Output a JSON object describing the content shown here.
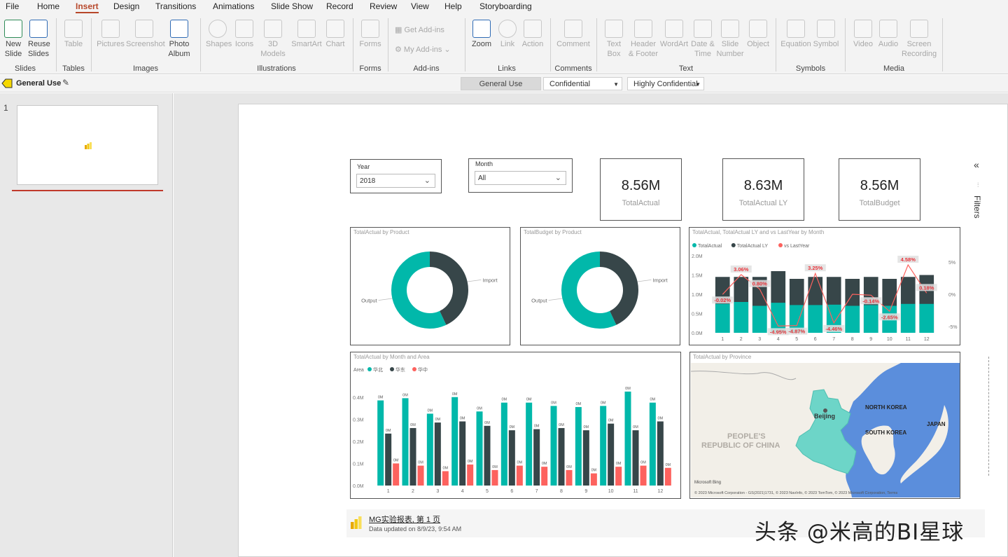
{
  "ribbon_tabs": [
    "File",
    "Home",
    "Insert",
    "Design",
    "Transitions",
    "Animations",
    "Slide Show",
    "Record",
    "Review",
    "View",
    "Help",
    "Storyboarding"
  ],
  "active_tab": "Insert",
  "ribbon": {
    "slides": {
      "new_slide": "New",
      "new_slide2": "Slide",
      "reuse": "Reuse",
      "reuse2": "Slides",
      "label": "Slides"
    },
    "tables": {
      "table": "Table",
      "label": "Tables"
    },
    "images": {
      "pictures": "Pictures",
      "screenshot": "Screenshot",
      "photo": "Photo",
      "album": "Album",
      "label": "Images"
    },
    "illustrations": {
      "shapes": "Shapes",
      "icons": "Icons",
      "models": "3D",
      "models2": "Models",
      "smartart": "SmartArt",
      "chart": "Chart",
      "label": "Illustrations"
    },
    "forms": {
      "forms": "Forms",
      "label": "Forms"
    },
    "addins": {
      "get": "Get Add-ins",
      "my": "My Add-ins",
      "label": "Add-ins"
    },
    "links": {
      "zoom": "Zoom",
      "link": "Link",
      "action": "Action",
      "label": "Links"
    },
    "comments": {
      "comment": "Comment",
      "label": "Comments"
    },
    "text": {
      "textbox": "Text",
      "textbox2": "Box",
      "header": "Header",
      "header2": "& Footer",
      "wordart": "WordArt",
      "datetime": "Date &",
      "datetime2": "Time",
      "slidenum": "Slide",
      "slidenum2": "Number",
      "object": "Object",
      "label": "Text"
    },
    "symbols": {
      "equation": "Equation",
      "symbol": "Symbol",
      "label": "Symbols"
    },
    "media": {
      "video": "Video",
      "audio": "Audio",
      "screen": "Screen",
      "screen2": "Recording",
      "label": "Media"
    }
  },
  "sensitivity": {
    "current": "General Use",
    "options": [
      "General Use",
      "Confidential",
      "Highly Confidential"
    ]
  },
  "slide_number": "1",
  "report": {
    "year_slicer": {
      "label": "Year",
      "value": "2018"
    },
    "month_slicer": {
      "label": "Month",
      "value": "All"
    },
    "kpis": [
      {
        "value": "8.56M",
        "label": "TotalActual"
      },
      {
        "value": "8.63M",
        "label": "TotalActual LY"
      },
      {
        "value": "8.56M",
        "label": "TotalBudget"
      }
    ],
    "filters_label": "Filters",
    "footer_title": "MG实验报表, 第 1 页",
    "footer_updated": "Data updated on 8/9/23, 9:54 AM"
  },
  "watermark": "头条 @米高的BI星球",
  "chart_data": [
    {
      "type": "pie",
      "title": "TotalActual by Product",
      "categories": [
        "Import",
        "Output"
      ],
      "values": [
        43,
        57
      ],
      "colors": [
        "#374649",
        "#01b8aa"
      ]
    },
    {
      "type": "pie",
      "title": "TotalBudget by Product",
      "categories": [
        "Import",
        "Output"
      ],
      "values": [
        43,
        57
      ],
      "colors": [
        "#374649",
        "#01b8aa"
      ]
    },
    {
      "type": "bar",
      "title": "TotalActual, TotalActual LY and vs LastYear by Month",
      "categories": [
        "1",
        "2",
        "3",
        "4",
        "5",
        "6",
        "7",
        "8",
        "9",
        "10",
        "11",
        "12"
      ],
      "series": [
        {
          "name": "TotalActual",
          "values": [
            0.75,
            0.8,
            0.7,
            0.78,
            0.72,
            0.72,
            0.73,
            0.7,
            0.72,
            0.7,
            0.75,
            0.75
          ],
          "color": "#01b8aa"
        },
        {
          "name": "TotalActual LY",
          "values": [
            1.45,
            1.45,
            1.45,
            1.6,
            1.4,
            1.45,
            1.45,
            1.4,
            1.45,
            1.4,
            1.45,
            1.5
          ],
          "color": "#374649"
        },
        {
          "name": "vs LastYear",
          "values": [
            -0.02,
            3.06,
            0.8,
            -4.95,
            -4.87,
            3.25,
            -4.46,
            null,
            -0.14,
            -2.65,
            4.58,
            0.18
          ],
          "color": "#fd625e",
          "type": "line",
          "axis": "right"
        }
      ],
      "line_labels": [
        "-0.02%",
        "3.06%",
        "0.80%",
        "-4.95%",
        "-4.87%",
        "3.25%",
        "-4.46%",
        "",
        "-0.14%",
        "-2.65%",
        "4.58%",
        "0.18%"
      ],
      "y_ticks": [
        "0.0M",
        "0.5M",
        "1.0M",
        "1.5M",
        "2.0M"
      ],
      "y2_ticks": [
        "5%",
        "0%",
        "-5%"
      ],
      "ylim": [
        0,
        2.0
      ],
      "y2lim": [
        -6,
        6
      ]
    },
    {
      "type": "bar",
      "title": "TotalActual by Month and Area",
      "legend_title": "Area",
      "categories": [
        "1",
        "2",
        "3",
        "4",
        "5",
        "6",
        "7",
        "8",
        "9",
        "10",
        "11",
        "12"
      ],
      "series": [
        {
          "name": "华北",
          "values": [
            0.385,
            0.395,
            0.325,
            0.4,
            0.335,
            0.375,
            0.375,
            0.36,
            0.355,
            0.36,
            0.425,
            0.375
          ],
          "color": "#01b8aa"
        },
        {
          "name": "华东",
          "values": [
            0.235,
            0.26,
            0.285,
            0.29,
            0.27,
            0.25,
            0.255,
            0.26,
            0.25,
            0.28,
            0.25,
            0.29
          ],
          "color": "#374649"
        },
        {
          "name": "华中",
          "values": [
            0.1,
            0.09,
            0.065,
            0.095,
            0.07,
            0.09,
            0.085,
            0.07,
            0.055,
            0.085,
            0.09,
            0.08
          ],
          "color": "#fd625e"
        }
      ],
      "data_label": "0M",
      "y_ticks": [
        "0.0M",
        "0.1M",
        "0.2M",
        "0.3M",
        "0.4M"
      ],
      "ylim": [
        0,
        0.45
      ]
    }
  ],
  "map": {
    "title": "TotalActual by Province",
    "labels": {
      "beijing": "Beijing",
      "north_korea": "NORTH KOREA",
      "south_korea": "SOUTH KOREA",
      "japan": "JAPAN",
      "china1": "PEOPLE'S",
      "china2": "REPUBLIC OF CHINA"
    },
    "bing": "Microsoft Bing",
    "copyright": "© 2023 Microsoft Corporation - GS(2021)1731, © 2023 NavInfo, © 2023 TomTom, © 2023 Microsoft Corporation, Terms"
  }
}
